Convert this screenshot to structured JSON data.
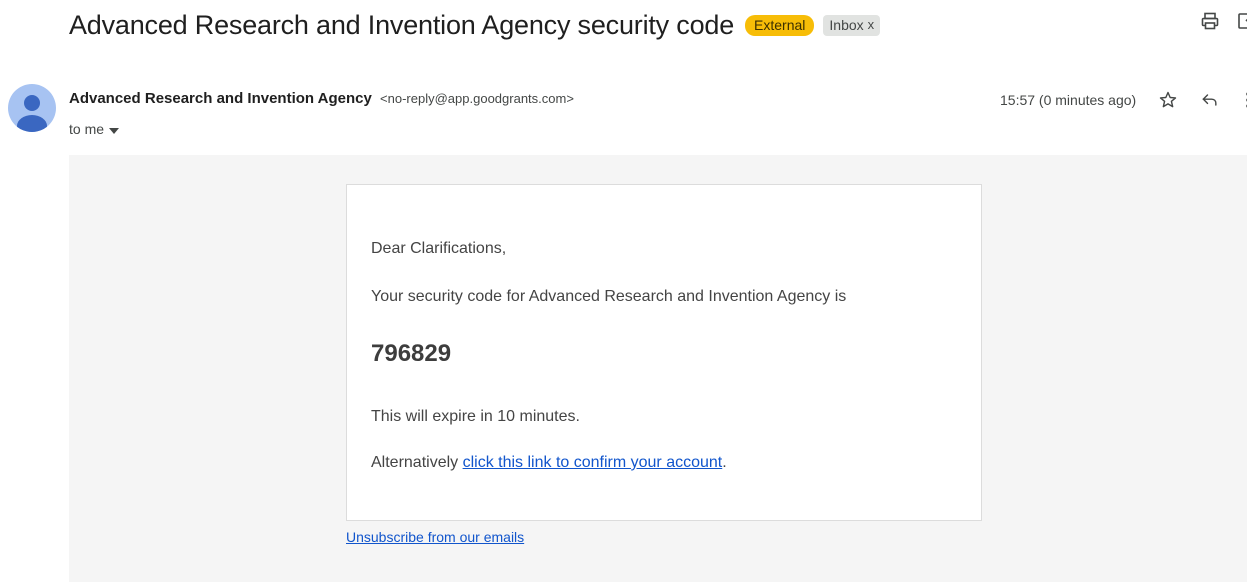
{
  "header": {
    "subject": "Advanced Research and Invention Agency security code",
    "labels": {
      "external": "External",
      "inbox": "Inbox",
      "inbox_remove": "x"
    },
    "icons": [
      "print-icon",
      "open-in-new-window-icon"
    ]
  },
  "sender": {
    "name": "Advanced Research and Invention Agency",
    "email": "<no-reply@app.goodgrants.com>",
    "recipient": "to me",
    "time": "15:57 (0 minutes ago)",
    "icons": [
      "star-icon",
      "reply-icon",
      "more-options-icon"
    ]
  },
  "message": {
    "greeting": "Dear Clarifications,",
    "intro": "Your security code for Advanced Research and Invention Agency is",
    "code": "796829",
    "expiry": "This will expire in 10 minutes.",
    "alt_prefix": "Alternatively ",
    "alt_link": "click this link to confirm your account",
    "alt_suffix": ".",
    "unsubscribe": "Unsubscribe from our emails"
  },
  "colors": {
    "external_label": "#f7bd07",
    "inbox_label": "#e1e3e1",
    "avatar": "#a7c3f2",
    "link": "#1155cc",
    "body_background": "#f5f5f5"
  }
}
